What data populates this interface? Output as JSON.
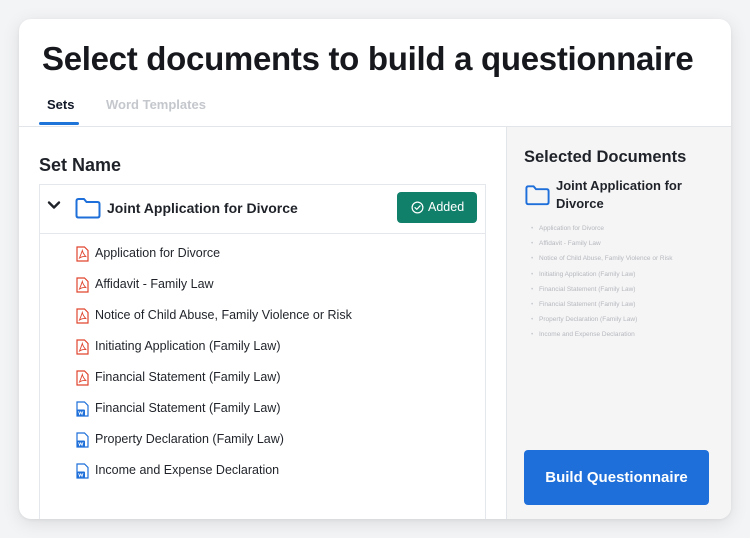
{
  "title": "Select documents to build a questionnaire",
  "tabs": [
    {
      "label": "Sets",
      "active": true
    },
    {
      "label": "Word Templates",
      "active": false
    }
  ],
  "set_section": {
    "heading": "Set Name",
    "set": {
      "name": "Joint Application for Divorce",
      "status_label": "Added",
      "expanded": true,
      "documents": [
        {
          "label": "Application for Divorce",
          "type": "pdf"
        },
        {
          "label": "Affidavit - Family Law",
          "type": "pdf"
        },
        {
          "label": "Notice of Child Abuse, Family Violence or Risk",
          "type": "pdf"
        },
        {
          "label": "Initiating Application (Family Law)",
          "type": "pdf"
        },
        {
          "label": "Financial Statement (Family Law)",
          "type": "pdf"
        },
        {
          "label": "Financial Statement (Family Law)",
          "type": "word"
        },
        {
          "label": "Property Declaration (Family Law)",
          "type": "word"
        },
        {
          "label": "Income and Expense Declaration",
          "type": "word"
        }
      ]
    }
  },
  "selected": {
    "heading": "Selected Documents",
    "set_name": "Joint Application for Divorce",
    "items": [
      "Application for Divorce",
      "Affidavit - Family Law",
      "Notice of Child Abuse, Family Violence or Risk",
      "Initiating Application (Family Law)",
      "Financial Statement (Family Law)",
      "Financial Statement (Family Law)",
      "Property Declaration (Family Law)",
      "Income and Expense Declaration"
    ],
    "button_label": "Build Questionnaire"
  },
  "colors": {
    "accent": "#1e6fd9",
    "added_green": "#11806a",
    "pdf_red": "#e0452f",
    "word_blue": "#1e6fd9"
  }
}
